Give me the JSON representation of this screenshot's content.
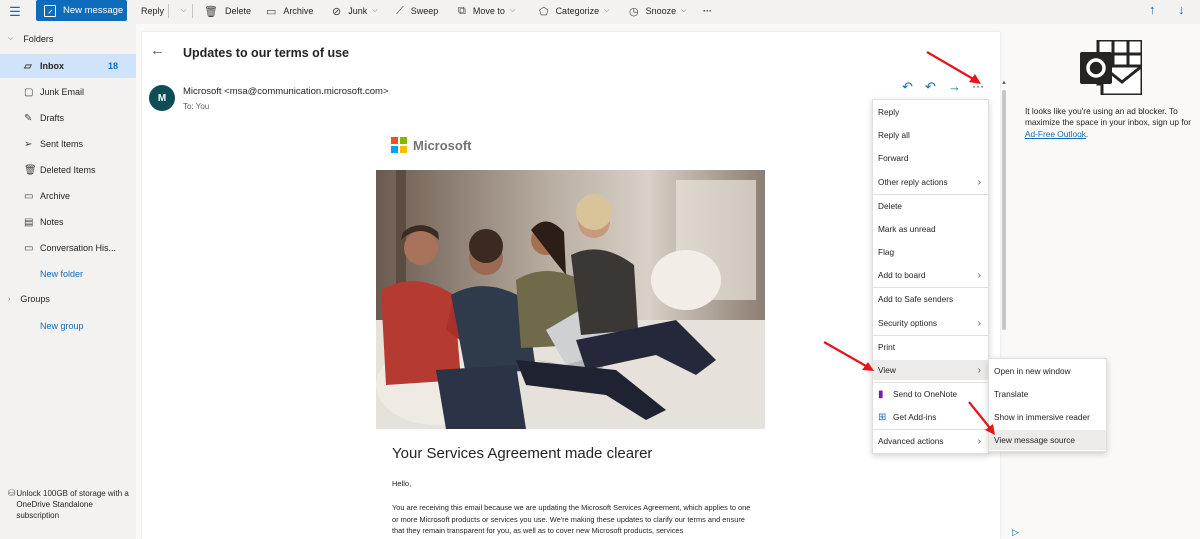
{
  "toolbar": {
    "new_message": "New message",
    "reply": "Reply",
    "delete": "Delete",
    "archive": "Archive",
    "junk": "Junk",
    "sweep": "Sweep",
    "move_to": "Move to",
    "categorize": "Categorize",
    "snooze": "Snooze",
    "more": "···"
  },
  "sidebar": {
    "folders_header": "Folders",
    "items": [
      {
        "label": "Inbox",
        "count": "18",
        "icon": "inbox-icon"
      },
      {
        "label": "Junk Email",
        "icon": "junk-icon"
      },
      {
        "label": "Drafts",
        "icon": "pencil-icon"
      },
      {
        "label": "Sent Items",
        "icon": "send-icon"
      },
      {
        "label": "Deleted Items",
        "icon": "trash-icon"
      },
      {
        "label": "Archive",
        "icon": "archive-icon"
      },
      {
        "label": "Notes",
        "icon": "note-icon"
      },
      {
        "label": "Conversation His...",
        "icon": "folder-icon"
      }
    ],
    "new_folder": "New folder",
    "groups_header": "Groups",
    "new_group": "New group",
    "unlock_text": "Unlock 100GB of storage with a OneDrive Standalone subscription"
  },
  "message": {
    "subject": "Updates to our terms of use",
    "avatar_initial": "M",
    "sender": "Microsoft <msa@communication.microsoft.com>",
    "to": "To:  You",
    "brand": "Microsoft",
    "headline": "Your Services Agreement made clearer",
    "greeting": "Hello,",
    "body": "You are receiving this email because we are updating the Microsoft Services Agreement, which applies to one or more Microsoft products or services you use. We're making these updates to clarify our terms and ensure that they remain transparent for you, as well as to cover new Microsoft products, services"
  },
  "context_menu": {
    "items": [
      {
        "label": "Reply",
        "submenu": false
      },
      {
        "label": "Reply all",
        "submenu": false
      },
      {
        "label": "Forward",
        "submenu": false
      },
      {
        "label": "Other reply actions",
        "submenu": true
      },
      {
        "label": "Delete",
        "submenu": false
      },
      {
        "label": "Mark as unread",
        "submenu": false
      },
      {
        "label": "Flag",
        "submenu": false
      },
      {
        "label": "Add to board",
        "submenu": true
      },
      {
        "label": "Add to Safe senders",
        "submenu": false
      },
      {
        "label": "Security options",
        "submenu": true
      },
      {
        "label": "Print",
        "submenu": false
      },
      {
        "label": "View",
        "submenu": true
      },
      {
        "label": "Send to OneNote",
        "submenu": false,
        "icon": "onenote-icon"
      },
      {
        "label": "Get Add-ins",
        "submenu": false,
        "icon": "add-ins-icon"
      },
      {
        "label": "Advanced actions",
        "submenu": true
      }
    ]
  },
  "view_submenu": {
    "items": [
      {
        "label": "Open in new window"
      },
      {
        "label": "Translate"
      },
      {
        "label": "Show in immersive reader"
      },
      {
        "label": "View message source"
      }
    ]
  },
  "ad_pane": {
    "text": "It looks like you're using an ad blocker. To maximize the space in your inbox, sign up for",
    "link": "Ad-Free Outlook",
    "period": "."
  },
  "colors": {
    "accent": "#0f6cbd",
    "selected": "#cfe4fa",
    "annotation_arrow": "#e8141c"
  }
}
